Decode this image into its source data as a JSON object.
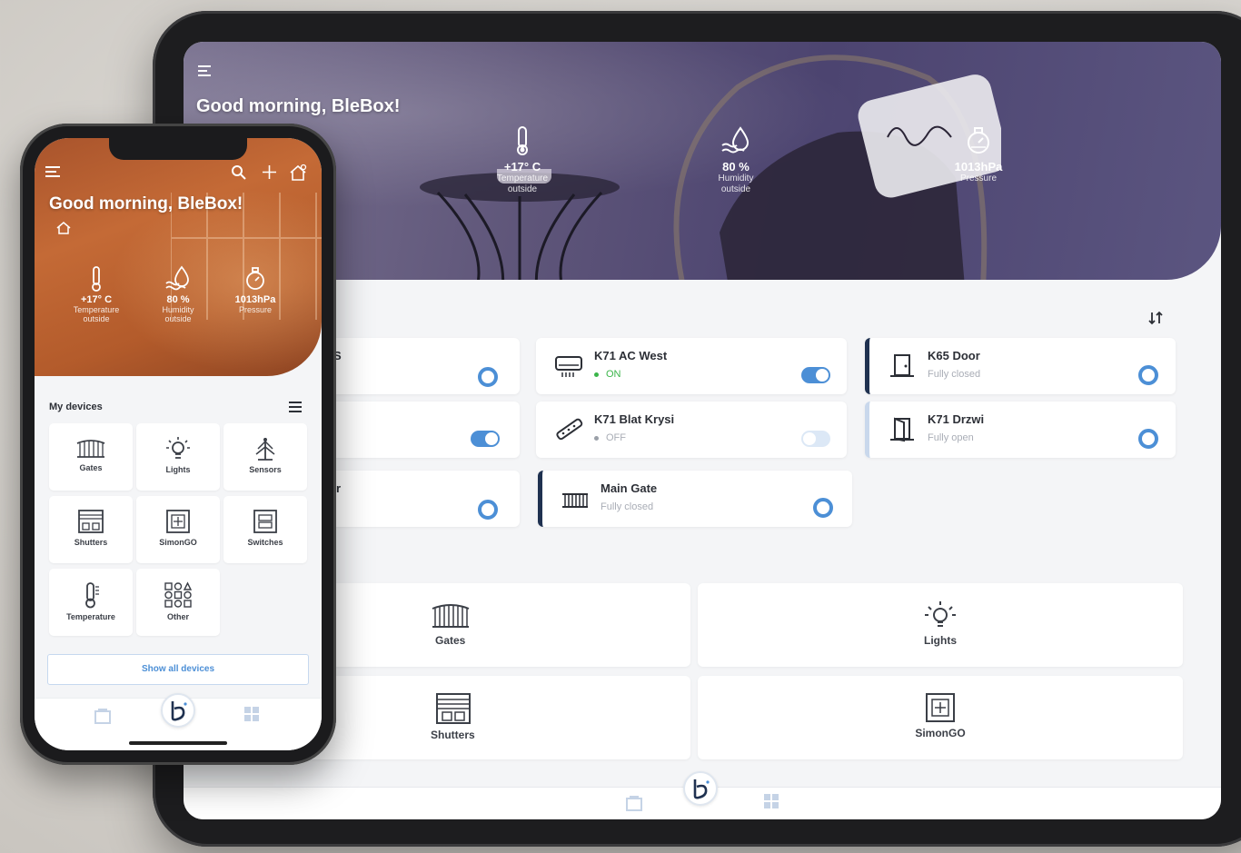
{
  "tablet": {
    "greeting": "Good morning, BleBox!",
    "stats": [
      {
        "value": "+17° C",
        "label_lines": [
          "Temperature",
          "outside"
        ],
        "icon": "thermometer-icon"
      },
      {
        "value": "80 %",
        "label_lines": [
          "Humidity",
          "outside"
        ],
        "icon": "humidity-icon"
      },
      {
        "value": "1013hPa",
        "label_lines": [
          "Pressure"
        ],
        "icon": "pressure-icon"
      }
    ],
    "devices": [
      {
        "name": "S",
        "status": "",
        "control": "ring"
      },
      {
        "name": "K71 AC West",
        "status": "ON",
        "control": "toggle-on",
        "icon": "air-conditioner-icon"
      },
      {
        "name": "K65 Door",
        "status": "Fully closed",
        "control": "ring",
        "icon": "door-icon"
      },
      {
        "name": "",
        "status": "",
        "control": "toggle-on"
      },
      {
        "name": "K71 Blat Krysi",
        "status": "OFF",
        "control": "toggle-off",
        "icon": "led-strip-icon"
      },
      {
        "name": "K71 Drzwi",
        "status": "Fully open",
        "control": "ring",
        "icon": "door-open-icon"
      },
      {
        "name": "or",
        "status": "",
        "control": "ring"
      },
      {
        "name": "Main Gate",
        "status": "Fully closed",
        "control": "ring",
        "icon": "gate-icon"
      }
    ],
    "categories": [
      {
        "label": "Gates",
        "icon": "gate-icon"
      },
      {
        "label": "Lights",
        "icon": "lightbulb-icon"
      },
      {
        "label": "Shutters",
        "icon": "shutter-icon"
      },
      {
        "label": "SimonGO",
        "icon": "socket-icon"
      }
    ]
  },
  "phone": {
    "greeting": "Good morning, BleBox!",
    "stats": [
      {
        "value": "+17° C",
        "label_lines": [
          "Temperature",
          "outside"
        ],
        "icon": "thermometer-icon"
      },
      {
        "value": "80 %",
        "label_lines": [
          "Humidity",
          "outside"
        ],
        "icon": "humidity-icon"
      },
      {
        "value": "1013hPa",
        "label_lines": [
          "Pressure"
        ],
        "icon": "pressure-icon"
      }
    ],
    "section_title": "My devices",
    "tiles": [
      {
        "label": "Gates",
        "icon": "gate-icon"
      },
      {
        "label": "Lights",
        "icon": "lightbulb-icon"
      },
      {
        "label": "Sensors",
        "icon": "sensor-icon"
      },
      {
        "label": "Shutters",
        "icon": "shutter-icon"
      },
      {
        "label": "SimonGO",
        "icon": "socket-icon"
      },
      {
        "label": "Switches",
        "icon": "switch-icon"
      },
      {
        "label": "Temperature",
        "icon": "thermometer-icon"
      },
      {
        "label": "Other",
        "icon": "other-icon"
      }
    ],
    "show_all": "Show all devices"
  },
  "colors": {
    "accent_blue": "#4c8fd6",
    "dark_navy": "#1f3150",
    "status_on": "#3bb54a",
    "tablet_hero": "#5e5579",
    "phone_hero": "#c46a36"
  }
}
